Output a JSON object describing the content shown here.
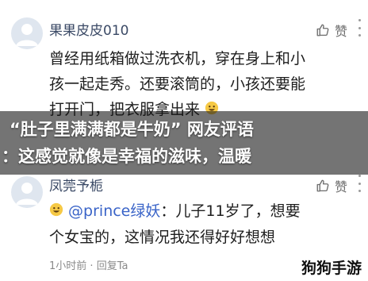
{
  "comment1": {
    "username": "果果皮皮010",
    "like_label": "赞",
    "text_line1": "曾经用纸箱做过洗衣机，穿在身上和小",
    "text_line2": "孩一起走秀。还要滚筒的，小孩还要能",
    "text_line3": "打开门，把衣服拿出来"
  },
  "headline": {
    "line1": "“肚子里满满都是牛奶” 网友评语",
    "line2": "：这感觉就像是幸福的滋味，温暖"
  },
  "comment2": {
    "username": "凤莞予栀",
    "like_label": "赞",
    "mention": "@prince绿妖",
    "text_after_mention": "：儿子11岁了，想要",
    "text_line2": "个女宝的，这情况我还得好好想想",
    "time": "1小时前",
    "reply": "回复Ta"
  },
  "watermark": "狗狗手游",
  "colors": {
    "username": "#3b4a66",
    "mention": "#3a64c8",
    "band": "#0f0f0f"
  },
  "icons": [
    "avatar-icon",
    "thumbs-up-icon",
    "more-icon",
    "grin-emoji-icon"
  ]
}
